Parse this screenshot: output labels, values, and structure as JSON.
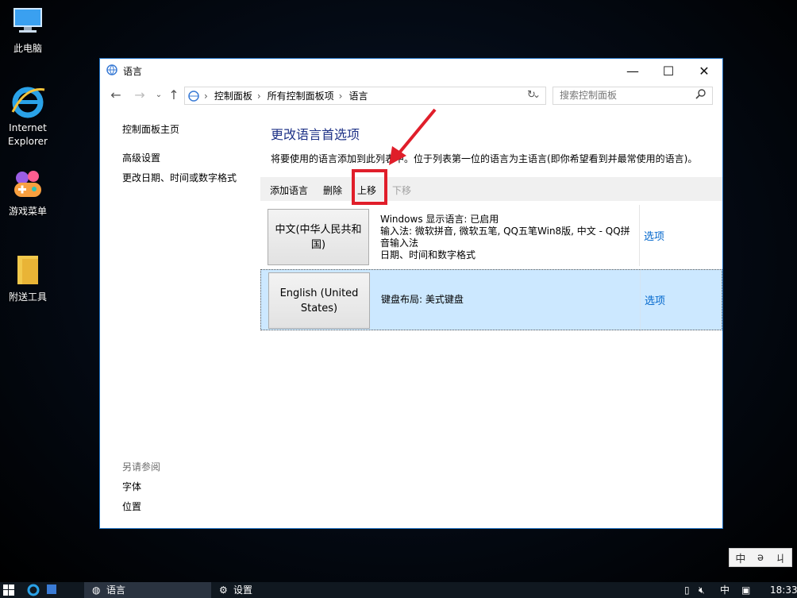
{
  "desktop": {
    "icons": [
      {
        "label": "此电脑"
      },
      {
        "label": "Internet Explorer"
      },
      {
        "label": "游戏菜单"
      },
      {
        "label": "附送工具"
      }
    ]
  },
  "window": {
    "title": "语言",
    "controls": {
      "minimize": "—",
      "maximize": "☐",
      "close": "✕"
    },
    "breadcrumb": [
      "控制面板",
      "所有控制面板项",
      "语言"
    ],
    "search_placeholder": "搜索控制面板"
  },
  "leftpane": {
    "home": "控制面板主页",
    "advanced": "高级设置",
    "datetime": "更改日期、时间或数字格式",
    "see_also_header": "另请参阅",
    "fonts": "字体",
    "location": "位置"
  },
  "main": {
    "heading": "更改语言首选项",
    "description": "将要使用的语言添加到此列表中。位于列表第一位的语言为主语言(即你希望看到并最常使用的语言)。",
    "toolbar": {
      "add": "添加语言",
      "remove": "删除",
      "move_up": "上移",
      "move_down": "下移"
    },
    "languages": [
      {
        "name": "中文(中华人民共和国)",
        "details": [
          "Windows 显示语言: 已启用",
          "输入法: 微软拼音, 微软五笔, QQ五笔Win8版, 中文 - QQ拼音输入法",
          "日期、时间和数字格式"
        ],
        "options": "选项"
      },
      {
        "name": "English (United States)",
        "details": [
          "键盘布局: 美式键盘"
        ],
        "options": "选项"
      }
    ]
  },
  "taskbar": {
    "items": [
      "语言",
      "设置"
    ],
    "ime": "中",
    "time": "18:33"
  },
  "ime_floating": [
    "中",
    "ə",
    "ㄐ"
  ],
  "colors": {
    "highlight": "#e01e2a",
    "selected_row": "#cce8ff",
    "link": "#0066cc",
    "heading": "#1e3287"
  }
}
